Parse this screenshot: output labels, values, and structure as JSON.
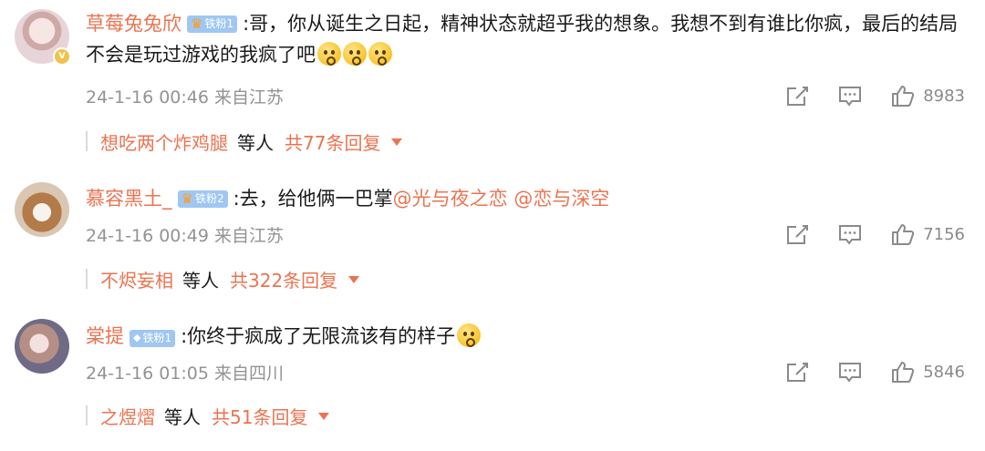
{
  "comments": [
    {
      "username": "草莓兔兔欣",
      "fan_badge": "铁粉1",
      "text": ":哥，你从诞生之日起，精神状态就超乎我的想象。我想不到有谁比你疯，最后的结局不会是玩过游戏的我疯了吧",
      "emoji_count": 3,
      "date": "24-1-16 00:46 来自江苏",
      "likes": "8983",
      "reply_user": "想吃两个炸鸡腿",
      "reply_etc": "等人",
      "reply_count": "共77条回复"
    },
    {
      "username": "慕容黑土_",
      "fan_badge": "铁粉2",
      "text": ":去，给他俩一巴掌",
      "mentions": [
        "@光与夜之恋",
        "@恋与深空"
      ],
      "date": "24-1-16 00:49 来自江苏",
      "likes": "7156",
      "reply_user": "不烬妄相",
      "reply_etc": "等人",
      "reply_count": "共322条回复"
    },
    {
      "username": "棠提",
      "fan_badge": "铁粉1",
      "text": ":你终于疯成了无限流该有的样子",
      "emoji_count": 1,
      "date": "24-1-16 01:05 来自四川",
      "likes": "5846",
      "reply_user": "之煜熠",
      "reply_etc": "等人",
      "reply_count": "共51条回复"
    }
  ],
  "colors": {
    "accent": "#eb7350",
    "meta": "#939393",
    "fan_badge": "#9fc7f2"
  },
  "icons": [
    "share-icon",
    "comment-icon",
    "like-icon",
    "chevron-down-icon"
  ]
}
